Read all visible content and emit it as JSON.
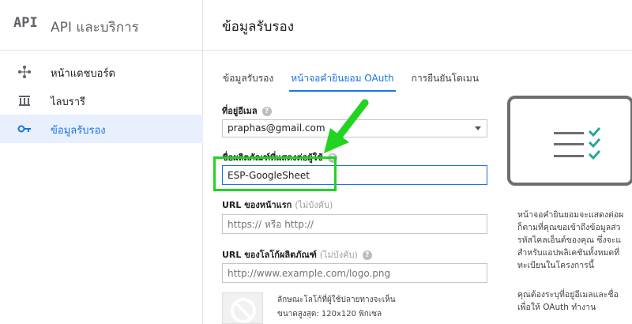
{
  "brand": {
    "logo": "API",
    "title": "API และบริการ"
  },
  "sidebar": {
    "items": [
      {
        "label": "หน้าแดชบอร์ด",
        "icon": "dashboard-icon"
      },
      {
        "label": "ไลบรารี",
        "icon": "library-icon"
      },
      {
        "label": "ข้อมูลรับรอง",
        "icon": "key-icon",
        "active": true
      }
    ]
  },
  "header": {
    "title": "ข้อมูลรับรอง"
  },
  "tabs": [
    {
      "label": "ข้อมูลรับรอง"
    },
    {
      "label": "หน้าจอคำยินยอม OAuth",
      "active": true
    },
    {
      "label": "การยืนยันโดเมน"
    }
  ],
  "form": {
    "email": {
      "label": "ที่อยู่อีเมล",
      "value": "praphas@gmail.com"
    },
    "product_name": {
      "label": "ชื่อผลิตภัณฑ์ที่แสดงต่อผู้ใช้",
      "value": "ESP-GoogleSheet"
    },
    "homepage": {
      "label": "URL ของหน้าแรก",
      "optional": "(ไม่บังคับ)",
      "placeholder": "https:// หรือ http://"
    },
    "logo_url": {
      "label": "URL ของโลโก้ผลิตภัณฑ์",
      "optional": "(ไม่บังคับ)",
      "placeholder": "http://www.example.com/logo.png"
    },
    "logo_hint_1": "ลักษณะโลโก้ที่ผู้ใช้ปลายทางจะเห็น",
    "logo_hint_2": "ขนาดสูงสุด: 120x120 พิกเซล"
  },
  "info": {
    "lines_1": [
      "หน้าจอคำยินยอมจะแสดงต่อผ",
      "ก็ตามที่คุณขอเข้าถึงข้อมูลส่ว",
      "รหัสไคลเอ็นต์ของคุณ ซึ่งจะแ",
      "สำหรับแอปพลิเคชันทั้งหมดที่",
      "ทะเบียนในโครงการนี้"
    ],
    "lines_2": [
      "คุณต้องระบุที่อยู่อีเมลและชื่อ",
      "เพื่อให้ OAuth ทำงาน"
    ]
  },
  "colors": {
    "accent": "#1a73e8",
    "highlight": "#22d322",
    "active_bg": "#e8f0fe"
  }
}
